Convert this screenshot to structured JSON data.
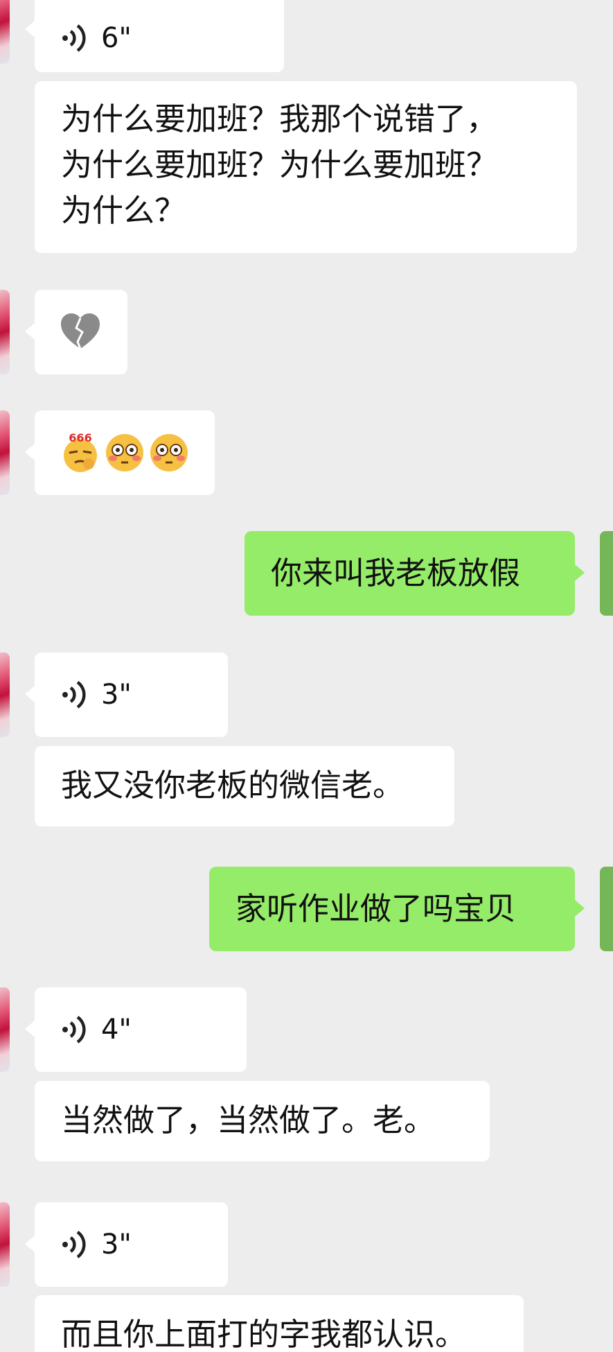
{
  "messages": [
    {
      "type": "voice",
      "duration": "6\""
    },
    {
      "type": "text",
      "text": "为什么要加班？我那个说错了，\n为什么要加班？为什么要加班？\n为什么？"
    },
    {
      "type": "emoji",
      "emojis": [
        "broken-heart"
      ]
    },
    {
      "type": "emoji",
      "emojis": [
        "666-face",
        "flushed-face",
        "flushed-face"
      ],
      "label": "666"
    },
    {
      "type": "text_out",
      "text": "你来叫我老板放假"
    },
    {
      "type": "voice",
      "duration": "3\""
    },
    {
      "type": "text",
      "text": "我又没你老板的微信老。"
    },
    {
      "type": "text_out",
      "text": "家听作业做了吗宝贝"
    },
    {
      "type": "voice",
      "duration": "4\""
    },
    {
      "type": "text",
      "text": "当然做了，当然做了。老。"
    },
    {
      "type": "voice",
      "duration": "3\""
    },
    {
      "type": "text",
      "text": "而且你上面打的字我都认识。"
    }
  ],
  "colors": {
    "background": "#ededed",
    "incoming_bubble": "#ffffff",
    "outgoing_bubble": "#95ec69"
  }
}
